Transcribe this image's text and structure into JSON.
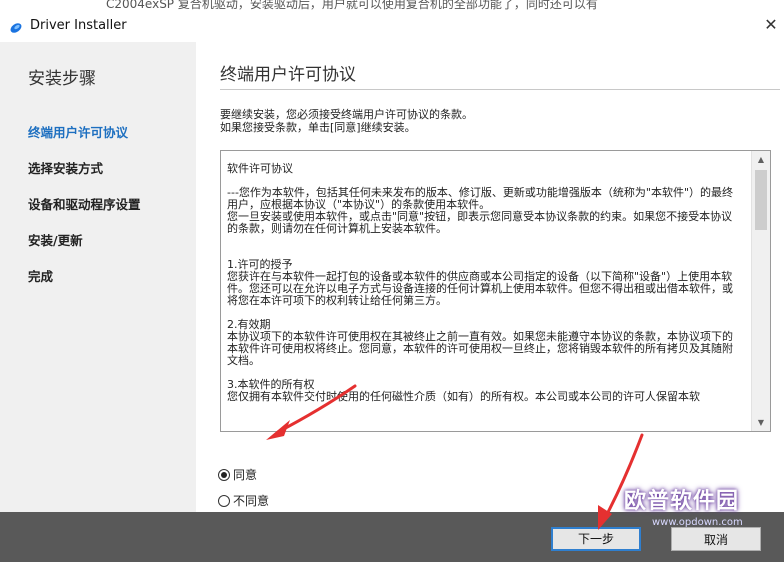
{
  "caption": "C2004exSP 复合机驱动，安装驱动后，用户就可以使用复合机的全部功能了，同时还可以有",
  "window": {
    "title": "Driver Installer"
  },
  "sidebar": {
    "title": "安装步骤",
    "items": [
      {
        "label": "终端用户许可协议",
        "active": true
      },
      {
        "label": "选择安装方式"
      },
      {
        "label": "设备和驱动程序设置"
      },
      {
        "label": "安装/更新"
      },
      {
        "label": "完成"
      }
    ]
  },
  "main": {
    "title": "终端用户许可协议",
    "intro_line1": "要继续安装，您必须接受终端用户许可协议的条款。",
    "intro_line2": "如果您接受条款，单击[同意]继续安装。",
    "license_text": "软件许可协议\n\n---您作为本软件，包括其任何未来发布的版本、修订版、更新或功能增强版本（统称为\"本软件\"）的最终用户，应根据本协议（\"本协议\"）的条款使用本软件。\n您一旦安装或使用本软件，或点击\"同意\"按钮，即表示您同意受本协议条款的约束。如果您不接受本协议的条款，则请勿在任何计算机上安装本软件。\n\n\n1.许可的授予\n您获许在与本软件一起打包的设备或本软件的供应商或本公司指定的设备（以下简称\"设备\"）上使用本软件。您还可以在允许以电子方式与设备连接的任何计算机上使用本软件。但您不得出租或出借本软件，或将您在本许可项下的权利转让给任何第三方。\n\n2.有效期\n本协议项下的本软件许可使用权在其被终止之前一直有效。如果您未能遵守本协议的条款，本协议项下的本软件许可使用权将终止。您同意，本软件的许可使用权一旦终止，您将销毁本软件的所有拷贝及其随附文档。\n\n3.本软件的所有权\n您仅拥有本软件交付时使用的任何磁性介质（如有）的所有权。本公司或本公司的许可人保留本软",
    "radio_agree": "同意",
    "radio_disagree": "不同意"
  },
  "footer": {
    "next_label": "下一步",
    "cancel_label": "取消"
  },
  "watermark": {
    "name": "欧普软件园",
    "url": "www.opdown.com"
  },
  "colors": {
    "accent": "#1d6fc0",
    "footer_bg": "#595959",
    "arrow": "#e53030",
    "sidebar_bg": "#f0f0f0"
  }
}
